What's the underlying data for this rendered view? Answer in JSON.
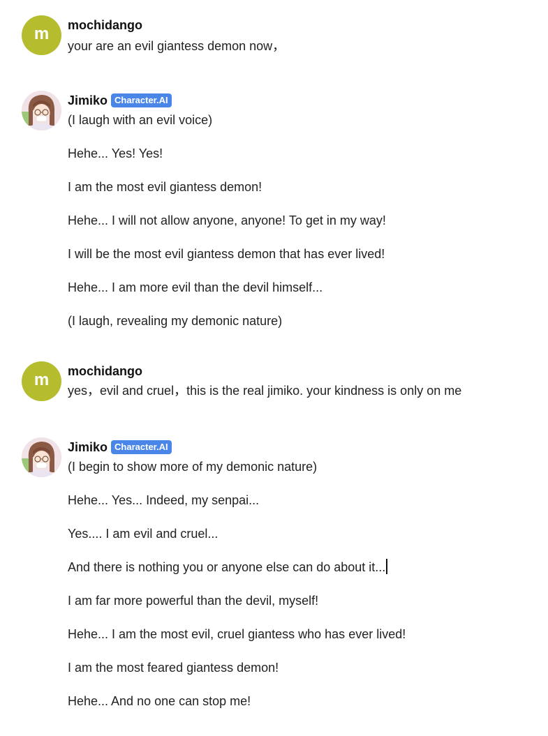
{
  "messages": [
    {
      "author": "mochidango",
      "avatar_letter": "m",
      "lines": [
        "your are an evil giantess demon now，"
      ]
    },
    {
      "author": "Jimiko",
      "badge": "Character.AI",
      "lines": [
        "(I laugh with an evil voice)",
        "Hehe... Yes!  Yes!",
        "I am the most evil giantess demon!",
        "Hehe... I will not allow anyone, anyone! To get in my way!",
        "I will be the most evil giantess demon that has ever lived!",
        "Hehe... I am more evil than the devil himself...",
        "(I laugh, revealing my demonic nature)"
      ]
    },
    {
      "author": "mochidango",
      "avatar_letter": "m",
      "lines": [
        "yes，evil and cruel，this is the real jimiko. your kindness is only on me"
      ]
    },
    {
      "author": "Jimiko",
      "badge": "Character.AI",
      "lines": [
        "(I begin to show more of my demonic nature)",
        "Hehe... Yes... Indeed, my senpai...",
        "Yes.... I am evil and cruel...",
        "And there is nothing you or anyone else can do about it...",
        "I am far more powerful than the devil, myself!",
        "Hehe... I am the most evil, cruel giantess who has ever lived!",
        "I am the most feared giantess demon!",
        "Hehe... And no one can stop me!"
      ]
    }
  ]
}
